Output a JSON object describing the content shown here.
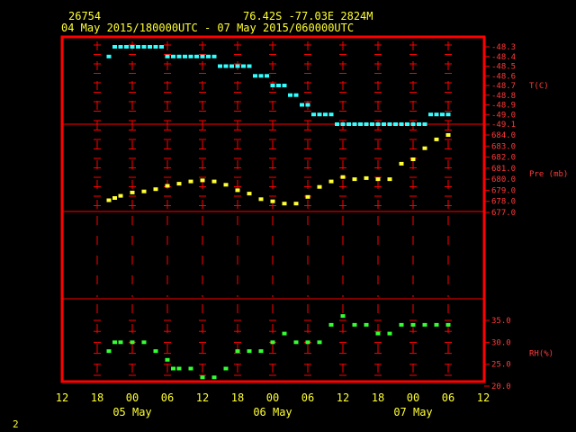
{
  "header": {
    "station": "26754",
    "location": "76.42S   -77.03E   2824M",
    "period": "04 May 2015/180000UTC - 07 May 2015/060000UTC"
  },
  "footer": {
    "page_number": "2"
  },
  "colors": {
    "background": "#000000",
    "frame": "#ff0000",
    "axis_text": "#ff3a3a",
    "header_text": "#ffff33",
    "temperature": "#33ffff",
    "pressure": "#ffff33",
    "humidity": "#33ff33"
  },
  "x_axis": {
    "hour_labels": [
      "12",
      "18",
      "00",
      "06",
      "12",
      "18",
      "00",
      "06",
      "12",
      "18",
      "00",
      "06",
      "12"
    ],
    "date_labels": [
      "05 May",
      "06 May",
      "07 May"
    ]
  },
  "chart_data": [
    {
      "type": "scatter",
      "panel": "temperature",
      "ylabel": "T(C)",
      "ylim": [
        -49.1,
        -48.3
      ],
      "yticks": [
        "-48.3",
        "-48.4",
        "-48.5",
        "-48.6",
        "-48.7",
        "-48.8",
        "-48.9",
        "-49.0",
        "-49.1"
      ],
      "x_unit": "hours since 04 May 2015 12:00 UTC",
      "series": [
        {
          "x": [
            8,
            9,
            10,
            11,
            12,
            13,
            14,
            15,
            16,
            17,
            18,
            19,
            20,
            21,
            22,
            23,
            24,
            25,
            26,
            27,
            28,
            29,
            30,
            31,
            32,
            33,
            34,
            35,
            36,
            37,
            38,
            39,
            40,
            41,
            42,
            43,
            44,
            45,
            46,
            47,
            48,
            49,
            50,
            51,
            52,
            53,
            54,
            55,
            56,
            57,
            58,
            59,
            60,
            61,
            62,
            63,
            64,
            65,
            66
          ],
          "y": [
            -48.4,
            -48.3,
            -48.3,
            -48.3,
            -48.3,
            -48.3,
            -48.3,
            -48.3,
            -48.3,
            -48.3,
            -48.4,
            -48.4,
            -48.4,
            -48.4,
            -48.4,
            -48.4,
            -48.4,
            -48.4,
            -48.4,
            -48.5,
            -48.5,
            -48.5,
            -48.5,
            -48.5,
            -48.5,
            -48.6,
            -48.6,
            -48.6,
            -48.7,
            -48.7,
            -48.7,
            -48.8,
            -48.8,
            -48.9,
            -48.9,
            -49.0,
            -49.0,
            -49.0,
            -49.0,
            -49.1,
            -49.1,
            -49.1,
            -49.1,
            -49.1,
            -49.1,
            -49.1,
            -49.1,
            -49.1,
            -49.1,
            -49.1,
            -49.1,
            -49.1,
            -49.1,
            -49.1,
            -49.1,
            -49.0,
            -49.0,
            -49.0,
            -49.0
          ]
        }
      ]
    },
    {
      "type": "scatter",
      "panel": "pressure",
      "ylabel": "Pre (mb)",
      "ylim": [
        677.0,
        684.0
      ],
      "yticks": [
        "684.0",
        "683.0",
        "682.0",
        "681.0",
        "680.0",
        "679.0",
        "678.0",
        "677.0"
      ],
      "x_unit": "hours since 04 May 2015 12:00 UTC",
      "series": [
        {
          "x": [
            8,
            9,
            10,
            12,
            14,
            16,
            18,
            20,
            22,
            24,
            26,
            28,
            30,
            32,
            34,
            36,
            38,
            40,
            42,
            44,
            46,
            48,
            50,
            52,
            54,
            56,
            58,
            60,
            62,
            64,
            66
          ],
          "y": [
            678.1,
            678.3,
            678.5,
            678.8,
            678.9,
            679.1,
            679.4,
            679.6,
            679.8,
            679.9,
            679.8,
            679.5,
            679.0,
            678.7,
            678.2,
            678.0,
            677.8,
            677.8,
            678.4,
            679.3,
            679.8,
            680.2,
            680.0,
            680.1,
            680.0,
            680.0,
            681.4,
            681.8,
            682.8,
            683.6,
            684.0
          ]
        }
      ]
    },
    {
      "type": "scatter",
      "panel": "humidity",
      "ylabel": "RH(%)",
      "ylim": [
        20.0,
        35.0
      ],
      "yticks": [
        "35.0",
        "30.0",
        "25.0",
        "20.0"
      ],
      "x_unit": "hours since 04 May 2015 12:00 UTC",
      "series": [
        {
          "x": [
            8,
            9,
            10,
            12,
            14,
            16,
            18,
            19,
            20,
            22,
            24,
            26,
            28,
            30,
            32,
            34,
            36,
            38,
            40,
            42,
            44,
            46,
            48,
            50,
            52,
            54,
            56,
            58,
            60,
            62,
            64,
            66
          ],
          "y": [
            28.0,
            30.0,
            30.0,
            30.0,
            30.0,
            28.0,
            26.0,
            24.0,
            24.0,
            24.0,
            22.0,
            22.0,
            24.0,
            28.0,
            28.0,
            28.0,
            30.0,
            32.0,
            30.0,
            30.0,
            30.0,
            34.0,
            36.0,
            34.0,
            34.0,
            32.0,
            32.0,
            34.0,
            34.0,
            34.0,
            34.0,
            34.0
          ]
        }
      ]
    }
  ]
}
